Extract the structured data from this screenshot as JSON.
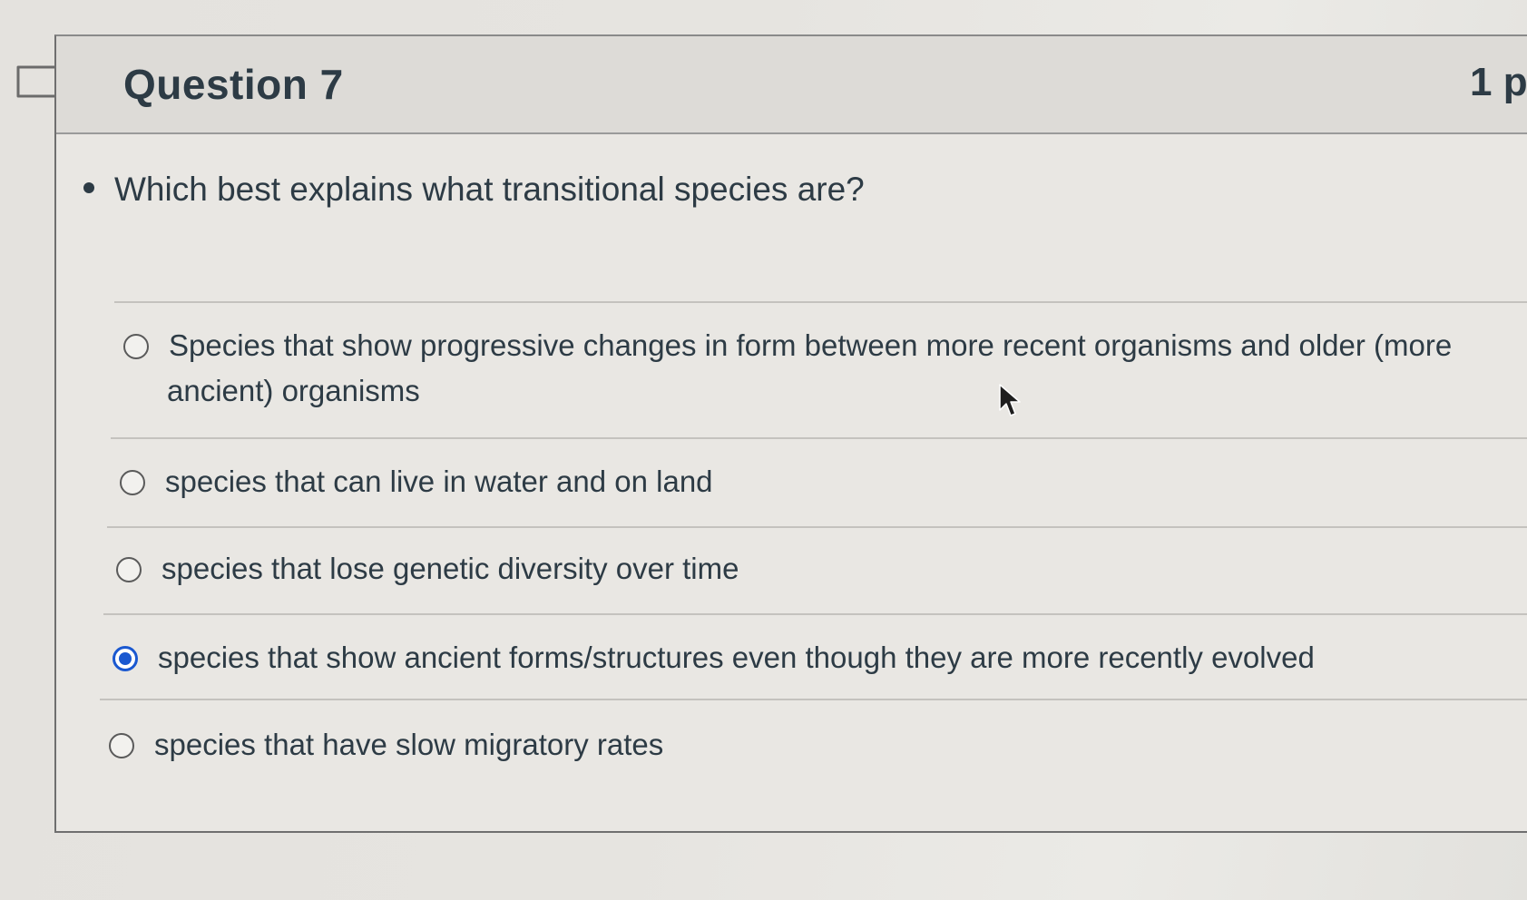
{
  "question": {
    "title": "Question 7",
    "points": "1 p",
    "prompt": "Which best explains what transitional species are?"
  },
  "answers": [
    {
      "line1": "Species that show progressive changes in form between more recent organisms and older (more",
      "line2": "ancient) organisms",
      "selected": false
    },
    {
      "line1": "species that can live in water and on land",
      "selected": false
    },
    {
      "line1": "species that lose genetic diversity over time",
      "selected": false
    },
    {
      "line1": "species that show ancient forms/structures even though they are more recently evolved",
      "selected": true
    },
    {
      "line1": "species that have slow migratory rates",
      "selected": false
    }
  ],
  "colors": {
    "text": "#2d3b45",
    "radio_selected": "#1a58d0"
  },
  "icons": {
    "bookmark": "bookmark-flag-icon",
    "cursor": "mouse-pointer-icon"
  }
}
